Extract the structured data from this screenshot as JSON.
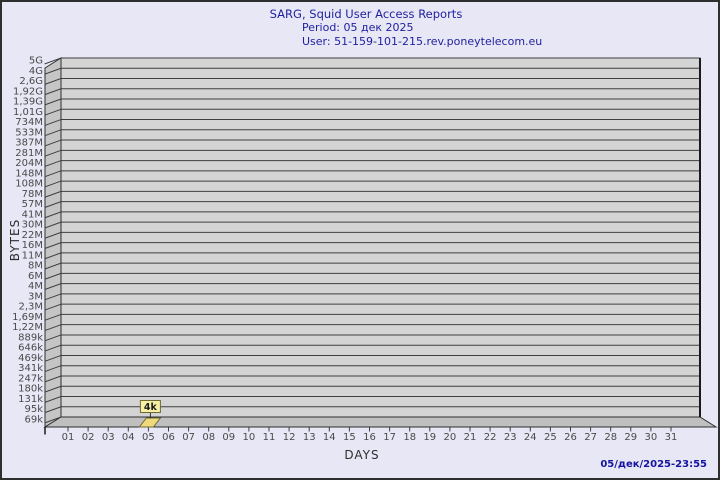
{
  "header": {
    "title": "SARG, Squid User Access Reports",
    "period": "Period: 05 дек 2025",
    "user": "User: 51-159-101-215.rev.poneytelecom.eu"
  },
  "footer": {
    "generated": "05/дек/2025-23:55"
  },
  "chart_data": {
    "type": "bar",
    "title": "SARG, Squid User Access Reports",
    "subtitle": [
      "Period: 05 дек 2025",
      "User: 51-159-101-215.rev.poneytelecom.eu"
    ],
    "xlabel": "DAYS",
    "ylabel": "BYTES",
    "x_tick_labels": [
      "01",
      "02",
      "03",
      "04",
      "05",
      "06",
      "07",
      "08",
      "09",
      "10",
      "11",
      "12",
      "13",
      "14",
      "15",
      "16",
      "17",
      "18",
      "19",
      "20",
      "21",
      "22",
      "23",
      "24",
      "25",
      "26",
      "27",
      "28",
      "29",
      "30",
      "31"
    ],
    "y_tick_labels": [
      "5G",
      "4G",
      "2,6G",
      "1,92G",
      "1,39G",
      "1,01G",
      "734M",
      "533M",
      "387M",
      "281M",
      "204M",
      "148M",
      "108M",
      "78M",
      "57M",
      "41M",
      "30M",
      "22M",
      "16M",
      "11M",
      "8M",
      "6M",
      "4M",
      "3M",
      "2,3M",
      "1,69M",
      "1,22M",
      "889k",
      "646k",
      "469k",
      "341k",
      "247k",
      "180k",
      "131k",
      "95k",
      "69k"
    ],
    "y_axis": {
      "scale": "log",
      "min_label": "69k",
      "max_label": "5G"
    },
    "grid": "horizontal",
    "values": [
      0,
      0,
      0,
      0,
      4000,
      0,
      0,
      0,
      0,
      0,
      0,
      0,
      0,
      0,
      0,
      0,
      0,
      0,
      0,
      0,
      0,
      0,
      0,
      0,
      0,
      0,
      0,
      0,
      0,
      0,
      0
    ],
    "bar_annotations": [
      {
        "day": "05",
        "label": "4k",
        "value_bytes": 4000
      }
    ],
    "colors": {
      "background": "#e7e7f6",
      "wall": "#d4d4d4",
      "side_wall": "#c5c5c5",
      "floor": "#bfbfbf",
      "grid_line": "#3f3f3f",
      "outline": "#2e2e2e",
      "bar": "#eeda7c",
      "bar_label_bg": "#f7f0a4",
      "bar_outline": "#6f6a33",
      "title_text": "#1f1f9e",
      "timestamp_text": "#1414a0",
      "tick_text": "#4a4a4a"
    }
  }
}
